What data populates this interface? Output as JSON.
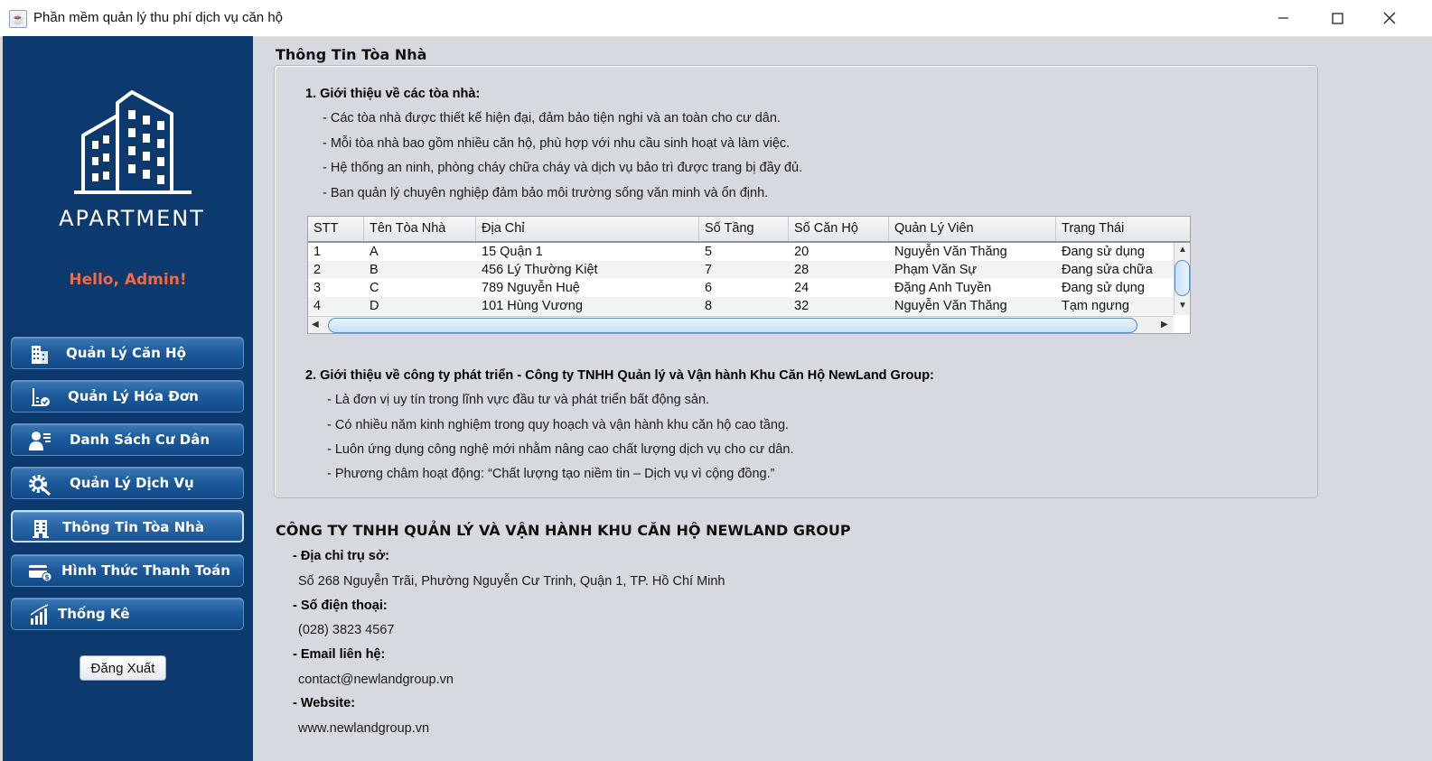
{
  "window": {
    "title": "Phần mềm quản lý thu phí dịch vụ căn hộ",
    "controls": [
      "minimize-icon",
      "maximize-icon",
      "close-icon"
    ]
  },
  "sidebar": {
    "logo_text": "APARTMENT",
    "greeting": "Hello, Admin!",
    "items": [
      {
        "label": "Quản Lý Căn Hộ",
        "icon": "building-icon"
      },
      {
        "label": "Quản Lý Hóa Đơn",
        "icon": "invoice-icon"
      },
      {
        "label": "Danh Sách Cư Dân",
        "icon": "resident-icon"
      },
      {
        "label": "Quản Lý Dịch Vụ",
        "icon": "gear-icon"
      },
      {
        "label": "Thông Tin Tòa Nhà",
        "icon": "tower-icon",
        "active": true
      },
      {
        "label": "Hình Thức Thanh Toán",
        "icon": "card-icon"
      },
      {
        "label": "Thống Kê",
        "icon": "chart-icon"
      }
    ],
    "logout_label": "Đăng Xuất"
  },
  "main": {
    "title": "Thông Tin Tòa Nhà",
    "intro_buildings": {
      "heading": "1. Giới thiệu về các tòa nhà:",
      "lines": [
        "- Các tòa nhà được thiết kế hiện đại, đảm bảo tiện nghi và an toàn cho cư dân.",
        "- Mỗi tòa nhà bao gồm nhiều căn hộ, phù hợp với nhu cầu sinh hoạt và làm việc.",
        "- Hệ thống an ninh, phòng cháy chữa cháy và dịch vụ bảo trì được trang bị đầy đủ.",
        "- Ban quản lý chuyên nghiệp đảm bảo môi trường sống văn minh và ổn định."
      ]
    },
    "table": {
      "columns": [
        "STT",
        "Tên Tòa Nhà",
        "Địa Chỉ",
        "Số Tầng",
        "Số Căn Hộ",
        "Quản Lý Viên",
        "Trạng Thái"
      ],
      "rows": [
        [
          "1",
          "A",
          "15 Quận 1",
          "5",
          "20",
          "Nguyễn Văn Thăng",
          "Đang sử dụng"
        ],
        [
          "2",
          "B",
          "456 Lý Thường Kiệt",
          "7",
          "28",
          "Phạm Văn Sự",
          "Đang sửa chữa"
        ],
        [
          "3",
          "C",
          "789 Nguyễn Huệ",
          "6",
          "24",
          "Đặng Anh Tuyền",
          "Đang sử dụng"
        ],
        [
          "4",
          "D",
          "101 Hùng Vương",
          "8",
          "32",
          "Nguyễn Văn Thăng",
          "Tạm ngưng"
        ]
      ]
    },
    "intro_company": {
      "heading": "2. Giới thiệu về công ty phát triển - Công ty TNHH Quản lý và Vận hành Khu Căn Hộ NewLand Group:",
      "lines": [
        "- Là đơn vị uy tín trong lĩnh vực đầu tư và phát triển bất động sản.",
        "- Có nhiều năm kinh nghiệm trong quy hoạch và vận hành khu căn hộ cao tầng.",
        "- Luôn ứng dụng công nghệ mới nhằm nâng cao chất lượng dịch vụ cho cư dân.",
        "- Phương châm hoạt động: “Chất lượng tạo niềm tin – Dịch vụ vì cộng đồng.”"
      ]
    },
    "company": {
      "name": "CÔNG TY TNHH QUẢN LÝ VÀ VẬN HÀNH KHU CĂN HỘ NEWLAND GROUP",
      "address_label": "- Địa chỉ trụ sở:",
      "address": "Số 268 Nguyễn Trãi, Phường Nguyễn Cư Trinh, Quận 1, TP. Hồ Chí Minh",
      "phone_label": "- Số điện thoại:",
      "phone": "(028) 3823 4567",
      "email_label": "- Email liên hệ:",
      "email": "contact@newlandgroup.vn",
      "website_label": "- Website:",
      "website": "www.newlandgroup.vn"
    }
  }
}
